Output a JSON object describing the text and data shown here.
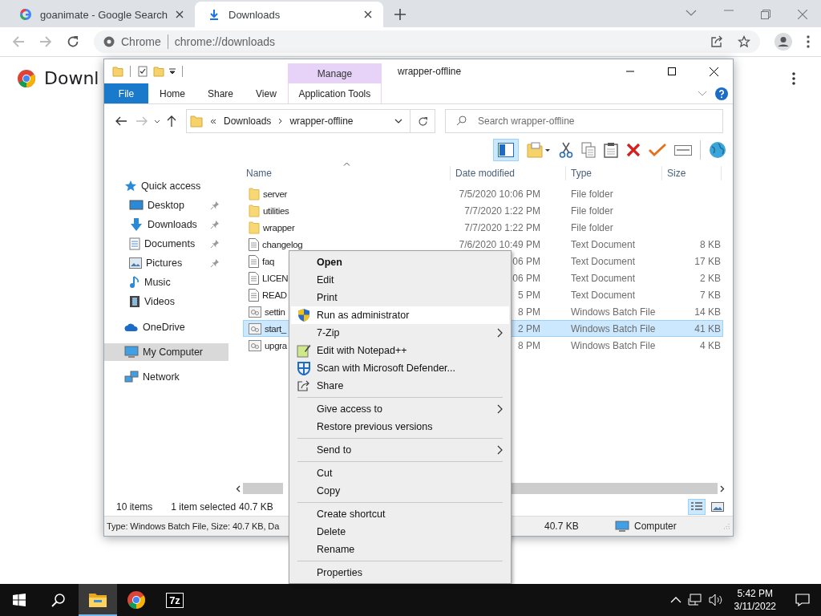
{
  "browser": {
    "tabs": [
      {
        "title": "goanimate - Google Search",
        "selected": false
      },
      {
        "title": "Downloads",
        "selected": true
      }
    ],
    "omnibox": {
      "chip": "Chrome",
      "url": "chrome://downloads"
    },
    "page": {
      "heading": "Downl"
    }
  },
  "explorer": {
    "title": "wrapper-offline",
    "context_tab": "Manage",
    "ribbon_tabs": [
      {
        "label": "File",
        "kind": "file",
        "selected": false
      },
      {
        "label": "Home",
        "kind": "tab",
        "selected": false
      },
      {
        "label": "Share",
        "kind": "tab",
        "selected": false
      },
      {
        "label": "View",
        "kind": "tab",
        "selected": false
      },
      {
        "label": "Application Tools",
        "kind": "context",
        "selected": false
      }
    ],
    "breadcrumbs": [
      "Downloads",
      "wrapper-offline"
    ],
    "search": {
      "placeholder": "Search wrapper-offline"
    },
    "nav": [
      {
        "label": "Quick access",
        "kind": "quick-access",
        "selected": false,
        "children": [
          {
            "label": "Desktop",
            "kind": "desktop",
            "pinned": true,
            "selected": false
          },
          {
            "label": "Downloads",
            "kind": "downloads",
            "pinned": true,
            "selected": false
          },
          {
            "label": "Documents",
            "kind": "documents",
            "pinned": true,
            "selected": false
          },
          {
            "label": "Pictures",
            "kind": "pictures",
            "pinned": true,
            "selected": false
          },
          {
            "label": "Music",
            "kind": "music",
            "pinned": false,
            "selected": false
          },
          {
            "label": "Videos",
            "kind": "videos",
            "pinned": false,
            "selected": false
          }
        ]
      },
      {
        "label": "OneDrive",
        "kind": "cloud",
        "selected": false
      },
      {
        "label": "My Computer",
        "kind": "computer",
        "selected": true
      },
      {
        "label": "Network",
        "kind": "network",
        "selected": false
      }
    ],
    "columns": [
      "Name",
      "Date modified",
      "Type",
      "Size"
    ],
    "files": [
      {
        "kind": "folder",
        "name": "server",
        "date": "7/5/2020 10:06 PM",
        "type": "File folder",
        "selected": false
      },
      {
        "kind": "folder",
        "name": "utilities",
        "date": "7/7/2020 1:22 PM",
        "type": "File folder",
        "selected": false
      },
      {
        "kind": "folder",
        "name": "wrapper",
        "date": "7/7/2020 1:22 PM",
        "type": "File folder",
        "selected": false
      },
      {
        "kind": "text",
        "name": "changelog",
        "date": "7/6/2020 10:49 PM",
        "type": "Text Document",
        "size": "8 KB",
        "selected": false
      },
      {
        "kind": "text",
        "name": "faq",
        "date": "06 PM",
        "type": "Text Document",
        "size": "17 KB",
        "selected": false
      },
      {
        "kind": "text",
        "name": "LICEN",
        "date": "06 PM",
        "type": "Text Document",
        "size": "2 KB",
        "selected": false
      },
      {
        "kind": "text",
        "name": "READ",
        "date": "5 PM",
        "type": "Text Document",
        "size": "7 KB",
        "selected": false
      },
      {
        "kind": "batch",
        "name": "settin",
        "date": "8 PM",
        "type": "Windows Batch File",
        "size": "14 KB",
        "selected": false
      },
      {
        "kind": "batch",
        "name": "start_",
        "date": "2 PM",
        "type": "Windows Batch File",
        "size": "41 KB",
        "selected": true
      },
      {
        "kind": "batch",
        "name": "upgra",
        "date": "8 PM",
        "type": "Windows Batch File",
        "size": "4 KB",
        "selected": false
      }
    ],
    "status": {
      "count": "10 items",
      "selection": "1 item selected",
      "selection_size": "40.7 KB"
    },
    "details_bar": {
      "info": "Type: Windows Batch File, Size: 40.7 KB, Da",
      "size": "40.7 KB",
      "location": "Computer"
    }
  },
  "context_menu": [
    {
      "kind": "command",
      "label": "Open",
      "default": true,
      "selected": false
    },
    {
      "kind": "command",
      "label": "Edit",
      "default": false,
      "selected": false
    },
    {
      "kind": "command",
      "label": "Print",
      "default": false,
      "selected": false
    },
    {
      "kind": "command",
      "label": "Run as administrator",
      "default": false,
      "selected": true
    },
    {
      "kind": "command",
      "label": "7-Zip",
      "default": false,
      "submenu": true,
      "selected": false
    },
    {
      "kind": "command",
      "label": "Edit with Notepad++",
      "default": false,
      "selected": false
    },
    {
      "kind": "command",
      "label": "Scan with Microsoft Defender...",
      "default": false,
      "selected": false
    },
    {
      "kind": "command",
      "label": "Share",
      "default": false,
      "selected": false
    },
    {
      "kind": "separator"
    },
    {
      "kind": "command",
      "label": "Give access to",
      "default": false,
      "submenu": true,
      "selected": false
    },
    {
      "kind": "command",
      "label": "Restore previous versions",
      "default": false,
      "selected": false
    },
    {
      "kind": "separator"
    },
    {
      "kind": "command",
      "label": "Send to",
      "default": false,
      "submenu": true,
      "selected": false
    },
    {
      "kind": "separator"
    },
    {
      "kind": "command",
      "label": "Cut",
      "default": false,
      "selected": false
    },
    {
      "kind": "command",
      "label": "Copy",
      "default": false,
      "selected": false
    },
    {
      "kind": "separator"
    },
    {
      "kind": "command",
      "label": "Create shortcut",
      "default": false,
      "selected": false
    },
    {
      "kind": "command",
      "label": "Delete",
      "default": false,
      "selected": false
    },
    {
      "kind": "command",
      "label": "Rename",
      "default": false,
      "selected": false
    },
    {
      "kind": "separator"
    },
    {
      "kind": "command",
      "label": "Properties",
      "default": false,
      "selected": false
    }
  ],
  "taskbar": {
    "apps": [
      {
        "kind": "explorer",
        "active": true
      },
      {
        "kind": "chrome",
        "active": false
      },
      {
        "kind": "archiver",
        "label": "7z",
        "active": false
      }
    ],
    "time": "5:42 PM",
    "date": "3/11/2022"
  }
}
